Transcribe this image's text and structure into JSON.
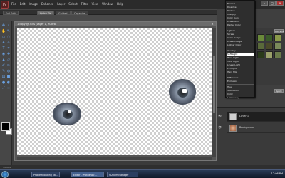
{
  "app": {
    "logo": "Pr",
    "menus": [
      "File",
      "Edit",
      "Image",
      "Enhance",
      "Layer",
      "Select",
      "Filter",
      "View",
      "Window",
      "Help"
    ],
    "window_buttons": [
      "–",
      "□",
      "×"
    ]
  },
  "tabs": [
    "Full Edit",
    "Quick Fix",
    "Guided",
    "Organize"
  ],
  "document": {
    "title": "1 copy @ 33% (Layer 1, RGB/8)",
    "close": "×"
  },
  "blend_menu": {
    "items": [
      "Normal",
      "Dissolve",
      "Darken",
      "Multiply",
      "Color Burn",
      "Linear Burn",
      "Darker Color",
      "Lighten",
      "Screen",
      "Color Dodge",
      "Linear Dodge",
      "Lighter Color",
      "Overlay",
      "Soft Light",
      "Hard Light",
      "Vivid Light",
      "Linear Light",
      "Pin Light",
      "Hard Mix",
      "Difference",
      "Exclusion",
      "Hue",
      "Saturation",
      "Color",
      "Luminosity"
    ],
    "selected": "Soft Light"
  },
  "effects": {
    "buttons": [
      "Quickfix",
      "Apply"
    ]
  },
  "layers": [
    {
      "name": "Layer 1",
      "active": true
    },
    {
      "name": "Background",
      "active": false
    }
  ],
  "status": {
    "zoom": "33.33%"
  },
  "taskbar": {
    "tasks": [
      "Problem loading pa...",
      "Editor - Photoshop ...",
      "VDicom Manager"
    ],
    "clock": "12:06 PM"
  }
}
